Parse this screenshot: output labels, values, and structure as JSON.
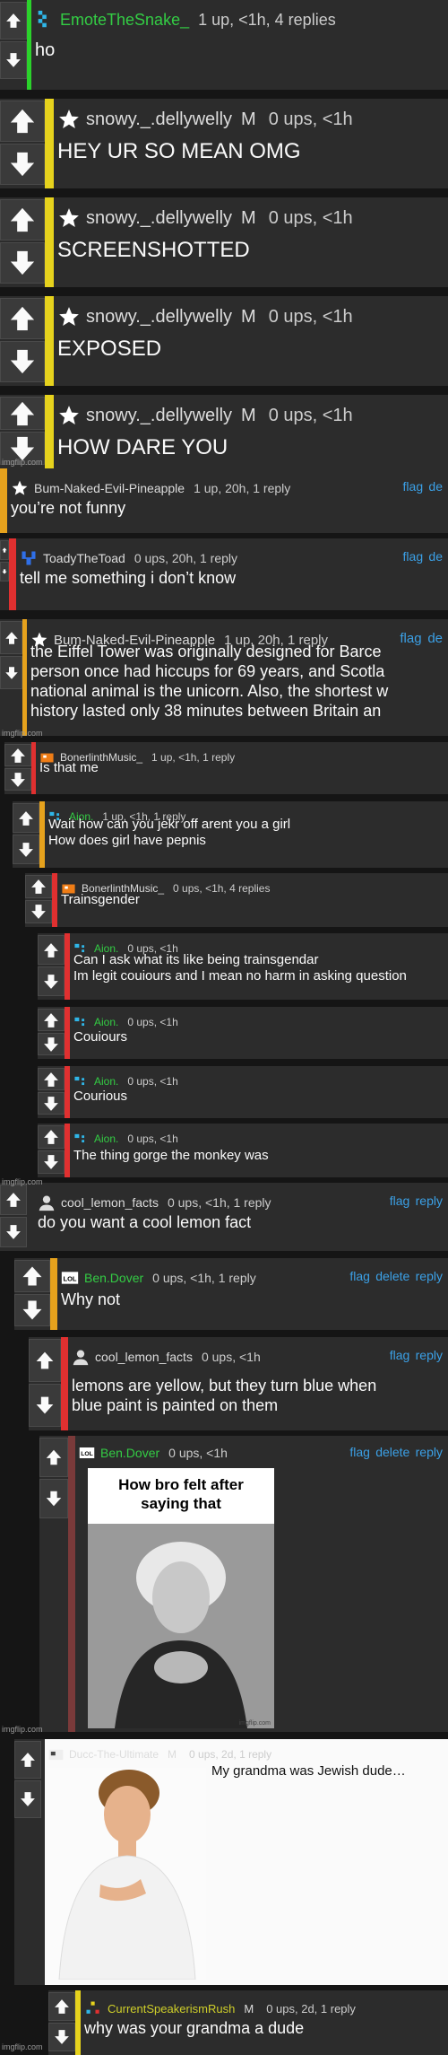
{
  "watermark": "imgflip.com",
  "comments": [
    {
      "username": "EmoteTheSnake_",
      "meta": "1 up, <1h, 4 replies",
      "text": "ho",
      "color": "#2bd22b",
      "avatar": "snake-icon",
      "name_color": "#33cc44"
    },
    {
      "username": "snowy._.dellywelly",
      "badge": "M",
      "meta": "0 ups, <1h",
      "text": "HEY UR SO MEAN OMG",
      "color": "#e6d21d",
      "avatar": "star-icon"
    },
    {
      "username": "snowy._.dellywelly",
      "badge": "M",
      "meta": "0 ups, <1h",
      "text": "SCREENSHOTTED",
      "color": "#e6d21d",
      "avatar": "star-icon"
    },
    {
      "username": "snowy._.dellywelly",
      "badge": "M",
      "meta": "0 ups, <1h",
      "text": "EXPOSED",
      "color": "#e6d21d",
      "avatar": "star-icon"
    },
    {
      "username": "snowy._.dellywelly",
      "badge": "M",
      "meta": "0 ups, <1h",
      "text": "HOW DARE YOU",
      "color": "#e6d21d",
      "avatar": "star-icon"
    },
    {
      "username": "Bum-Naked-Evil-Pineapple",
      "meta": "1 up, 20h, 1 reply",
      "text": "you’re not funny",
      "color": "#e6a21d",
      "avatar": "star-icon",
      "actions": [
        "flag",
        "de"
      ]
    },
    {
      "username": "ToadyTheToad",
      "meta": "0 ups, 20h, 1 reply",
      "text": "tell me something i don’t know",
      "color": "#e03030",
      "avatar": "toad-icon",
      "actions": [
        "flag",
        "de"
      ]
    },
    {
      "username": "Bum-Naked-Evil-Pineapple",
      "meta": "1 up, 20h, 1 reply",
      "text": "the Eiffel Tower was originally designed for Barce\nperson once had hiccups for 69 years, and Scotla\nnational animal is the unicorn. Also, the shortest w\nhistory lasted only 38 minutes between Britain an",
      "color": "#e6a21d",
      "avatar": "star-icon",
      "actions": [
        "flag",
        "de"
      ]
    },
    {
      "username": "BonerlinthMusic_",
      "meta": "1 up, <1h, 1 reply",
      "text": "Is that me",
      "color": "#e03030",
      "avatar": "orange-avatar-icon"
    },
    {
      "username": "Aion.",
      "meta": "1 up, <1h, 1 reply",
      "text": "Wait how can you jekr off arent you a girl\nHow does girl have pepnis",
      "color": "#e6a21d",
      "avatar": "dots-icon",
      "name_color": "#33cc44"
    },
    {
      "username": "BonerlinthMusic_",
      "meta": "0 ups, <1h, 4 replies",
      "text": "Trainsgender",
      "color": "#e03030",
      "avatar": "orange-avatar-icon"
    },
    {
      "username": "Aion.",
      "meta": "0 ups, <1h",
      "text": "Can I ask what its like being trainsgendar\nIm legit couiours and I mean no harm in asking question",
      "color": "#e03030",
      "avatar": "dots-icon",
      "name_color": "#33cc44"
    },
    {
      "username": "Aion.",
      "meta": "0 ups, <1h",
      "text": "Couiours",
      "color": "#e03030",
      "avatar": "dots-icon",
      "name_color": "#33cc44"
    },
    {
      "username": "Aion.",
      "meta": "0 ups, <1h",
      "text": "Courious",
      "color": "#e03030",
      "avatar": "dots-icon",
      "name_color": "#33cc44"
    },
    {
      "username": "Aion.",
      "meta": "0 ups, <1h",
      "text": "The thing gorge the monkey was",
      "color": "#e03030",
      "avatar": "dots-icon",
      "name_color": "#33cc44"
    },
    {
      "username": "cool_lemon_facts",
      "meta": "0 ups, <1h, 1 reply",
      "text": "do you want a cool lemon fact",
      "color": "#2c2c2c",
      "avatar": "person-icon",
      "actions": [
        "flag",
        "reply"
      ]
    },
    {
      "username": "Ben.Dover",
      "meta": "0 ups, <1h, 1 reply",
      "text": "Why not",
      "color": "#e6a21d",
      "avatar": "lol-icon",
      "name_color": "#33cc44",
      "actions": [
        "flag",
        "delete",
        "reply"
      ]
    },
    {
      "username": "cool_lemon_facts",
      "meta": "0 ups, <1h",
      "text": "lemons are yellow, but they turn blue when\nblue paint is painted on them",
      "color": "#e03030",
      "avatar": "person-icon",
      "actions": [
        "flag",
        "reply"
      ]
    },
    {
      "username": "Ben.Dover",
      "meta": "0 ups, <1h",
      "text": "",
      "color": "#7a3a3a",
      "avatar": "lol-icon",
      "name_color": "#33cc44",
      "actions": [
        "flag",
        "delete",
        "reply"
      ]
    },
    {
      "username": "Ducc-The-Ultimate",
      "badge": "M",
      "meta": "0 ups, 2d, 1 reply",
      "text": "My grandma was Jewish dude…",
      "color": "#2c2c2c",
      "avatar": "duck-icon",
      "bg": "#fafafa",
      "text_color": "#111"
    },
    {
      "username": "CurrentSpeakerismRush",
      "badge": "M",
      "meta": "0 ups, 2d, 1 reply",
      "text": "why was your grandma a dude",
      "color": "#e6d21d",
      "avatar": "dots3-icon",
      "name_color": "#cfcf2a"
    }
  ],
  "meme": {
    "caption": "How bro felt after\nsaying that",
    "credit": "imgflip.com"
  }
}
